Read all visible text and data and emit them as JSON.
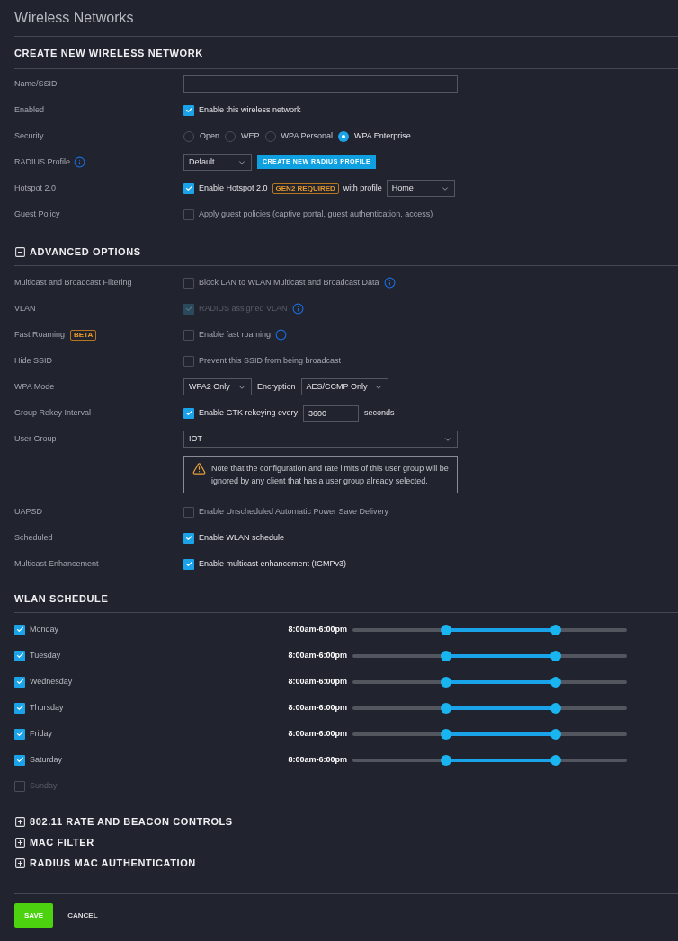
{
  "page_title": "Wireless Networks",
  "create_section": {
    "title": "CREATE NEW WIRELESS NETWORK",
    "rows": [
      {
        "label": "Name/SSID",
        "kind": "text"
      },
      {
        "label": "Enabled",
        "kind": "checkbox",
        "checkbox": {
          "text": "Enable this wireless network",
          "checked": true
        }
      },
      {
        "label": "Security",
        "kind": "radio",
        "options": [
          {
            "label": "Open",
            "selected": false
          },
          {
            "label": "WEP",
            "selected": false
          },
          {
            "label": "WPA Personal",
            "selected": false
          },
          {
            "label": "WPA Enterprise",
            "selected": true
          }
        ]
      },
      {
        "label": "RADIUS Profile",
        "info": true,
        "kind": "select_button",
        "select": "Default",
        "button": "CREATE NEW RADIUS PROFILE"
      },
      {
        "label": "Hotspot 2.0",
        "kind": "hotspot",
        "checkbox": {
          "text": "Enable Hotspot 2.0",
          "checked": true
        },
        "badge": "GEN2 REQUIRED",
        "suffix": "with profile",
        "select": "Home"
      },
      {
        "label": "Guest Policy",
        "kind": "checkbox",
        "checkbox": {
          "text": "Apply guest policies (captive portal, guest authentication, access)",
          "checked": false
        }
      }
    ]
  },
  "advanced": {
    "title": "ADVANCED OPTIONS",
    "expanded": true,
    "rows": [
      {
        "label": "Multicast and Broadcast Filtering",
        "kind": "checkbox",
        "checkbox": {
          "text": "Block LAN to WLAN Multicast and Broadcast Data",
          "checked": false,
          "info": true
        }
      },
      {
        "label": "VLAN",
        "kind": "checkbox",
        "checkbox": {
          "text": "RADIUS assigned VLAN",
          "checked": true,
          "disabled": true,
          "info": true
        }
      },
      {
        "label": "Fast Roaming",
        "label_badge": "BETA",
        "kind": "checkbox",
        "checkbox": {
          "text": "Enable fast roaming",
          "checked": false,
          "info": true
        }
      },
      {
        "label": "Hide SSID",
        "kind": "checkbox",
        "checkbox": {
          "text": "Prevent this SSID from being broadcast",
          "checked": false
        }
      },
      {
        "label": "WPA Mode",
        "kind": "wpa",
        "select": "WPA2 Only",
        "middle": "Encryption",
        "select2": "AES/CCMP Only"
      },
      {
        "label": "Group Rekey Interval",
        "kind": "rekey",
        "checkbox": {
          "text": "Enable GTK rekeying every",
          "checked": true
        },
        "value": "3600",
        "suffix": "seconds"
      },
      {
        "label": "User Group",
        "kind": "select_wide",
        "select": "IOT",
        "note": "Note that the configuration and rate limits of this user group will be ignored by any client that has a user group already selected."
      },
      {
        "label": "UAPSD",
        "kind": "checkbox",
        "checkbox": {
          "text": "Enable Unscheduled Automatic Power Save Delivery",
          "checked": false
        }
      },
      {
        "label": "Scheduled",
        "kind": "checkbox",
        "checkbox": {
          "text": "Enable WLAN schedule",
          "checked": true
        }
      },
      {
        "label": "Multicast Enhancement",
        "kind": "checkbox",
        "checkbox": {
          "text": "Enable multicast enhancement (IGMPv3)",
          "checked": true
        }
      }
    ]
  },
  "schedule": {
    "title": "WLAN SCHEDULE",
    "days": [
      {
        "day": "Monday",
        "checked": true,
        "hours": "8:00am-6:00pm",
        "thumbs": [
          {
            "level": 0.34
          },
          {
            "level": 0.74
          }
        ]
      },
      {
        "day": "Tuesday",
        "checked": true,
        "hours": "8:00am-6:00pm",
        "thumbs": [
          {
            "level": 0.34
          },
          {
            "level": 0.74
          }
        ]
      },
      {
        "day": "Wednesday",
        "checked": true,
        "hours": "8:00am-6:00pm",
        "thumbs": [
          {
            "level": 0.34
          },
          {
            "level": 0.74
          }
        ]
      },
      {
        "day": "Thursday",
        "checked": true,
        "hours": "8:00am-6:00pm",
        "thumbs": [
          {
            "level": 0.34
          },
          {
            "level": 0.74
          }
        ]
      },
      {
        "day": "Friday",
        "checked": true,
        "hours": "8:00am-6:00pm",
        "thumbs": [
          {
            "level": 0.34
          },
          {
            "level": 0.74
          }
        ]
      },
      {
        "day": "Saturday",
        "checked": true,
        "hours": "8:00am-6:00pm",
        "thumbs": [
          {
            "level": 0.34
          },
          {
            "level": 0.74
          }
        ]
      },
      {
        "day": "Sunday",
        "checked": false
      }
    ]
  },
  "collapsed_sections": [
    {
      "title": "802.11 RATE AND BEACON CONTROLS",
      "expanded": false
    },
    {
      "title": "MAC FILTER",
      "expanded": false
    },
    {
      "title": "RADIUS MAC AUTHENTICATION",
      "expanded": false
    }
  ],
  "buttons": [
    {
      "label": "SAVE",
      "kind": "primary"
    },
    {
      "label": "CANCEL",
      "kind": "plain"
    }
  ]
}
